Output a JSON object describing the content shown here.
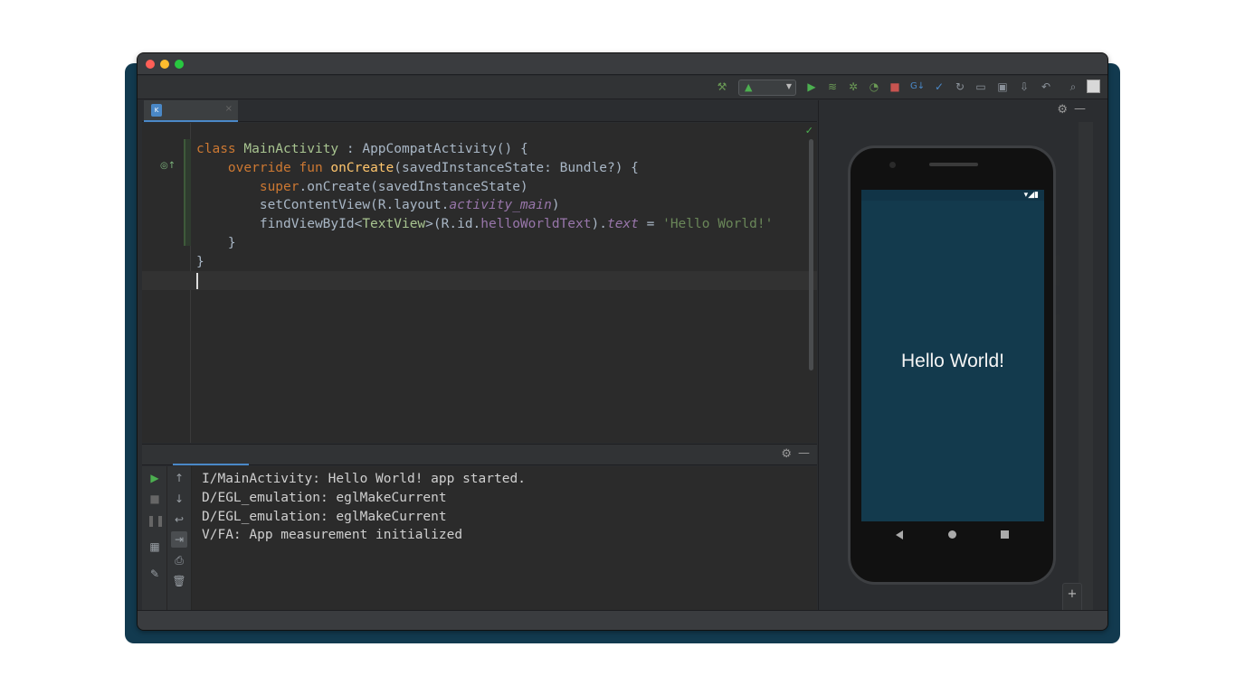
{
  "window": {
    "traffic_lights": [
      "close",
      "minimize",
      "maximize"
    ]
  },
  "toolbar": {
    "icons": [
      "build-hammer-icon",
      "run-icon",
      "apply-changes-icon",
      "debug-icon",
      "profile-icon",
      "stop-icon",
      "git-icon",
      "commit-icon",
      "layout-icon",
      "device-manager-icon",
      "sdk-manager-icon",
      "undo-icon",
      "search-icon",
      "avatar-icon"
    ],
    "device_icon": "android-icon"
  },
  "editor": {
    "tab_icon": "kotlin-file-icon",
    "tab_close": "×",
    "check": "✓",
    "lines": [
      "class MainActivity : AppCompatActivity() {",
      "    override fun onCreate(savedInstanceState: Bundle?) {",
      "        super.onCreate(savedInstanceState)",
      "        setContentView(R.layout.activity_main)",
      "        findViewById<TextView>(R.id.helloWorldText).text = 'Hello World!'",
      "    }",
      "}"
    ]
  },
  "logcat": {
    "lines": [
      "I/MainActivity: Hello World! app started.",
      "D/EGL_emulation: eglMakeCurrent",
      "D/EGL_emulation: eglMakeCurrent",
      "V/FA: App measurement initialized"
    ],
    "side_icons_left": [
      "run-icon",
      "stop-icon",
      "pause-icon",
      "layout-icon",
      "pin-icon"
    ],
    "side_icons_right": [
      "scroll-up-icon",
      "scroll-down-icon",
      "soft-wrap-icon",
      "scroll-to-end-icon",
      "print-icon",
      "trash-icon"
    ]
  },
  "preview": {
    "screen_text": "Hello World!",
    "zoom_in": "+",
    "zoom_out": "−"
  },
  "colors": {
    "backdrop": "#123a4f",
    "ide_bg": "#2b2d30",
    "phone_screen": "#133a4d",
    "accent": "#4a88c7"
  }
}
